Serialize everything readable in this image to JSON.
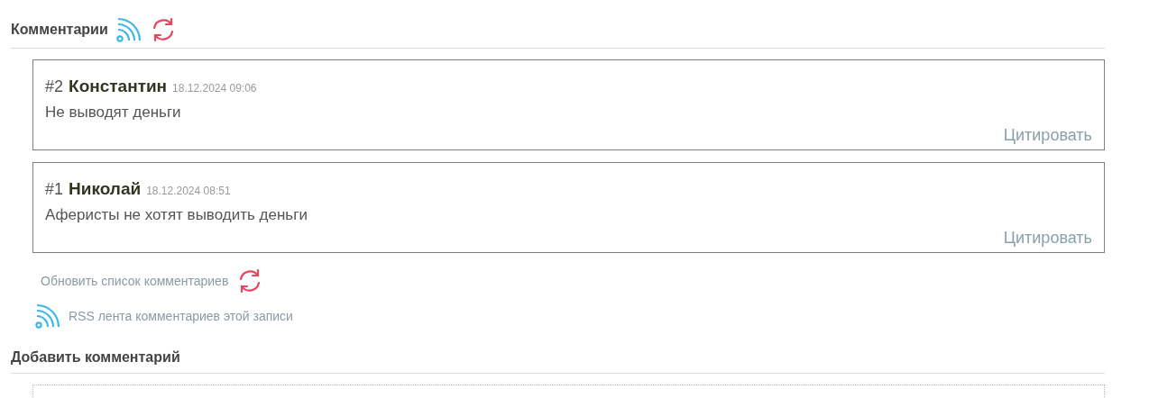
{
  "comments_section": {
    "title": "Комментарии"
  },
  "comments": [
    {
      "number": "#2",
      "author": "Константин",
      "date": "18.12.2024 09:06",
      "text": "Не выводят деньги",
      "quote_link": "Цитировать"
    },
    {
      "number": "#1",
      "author": "Николай",
      "date": "18.12.2024 08:51",
      "text": "Аферисты не хотят выводить деньги",
      "quote_link": "Цитировать"
    }
  ],
  "refresh_link": "Обновить список комментариев",
  "rss_link": "RSS лента комментариев этой записи",
  "add_comment": {
    "title": "Добавить комментарий"
  }
}
